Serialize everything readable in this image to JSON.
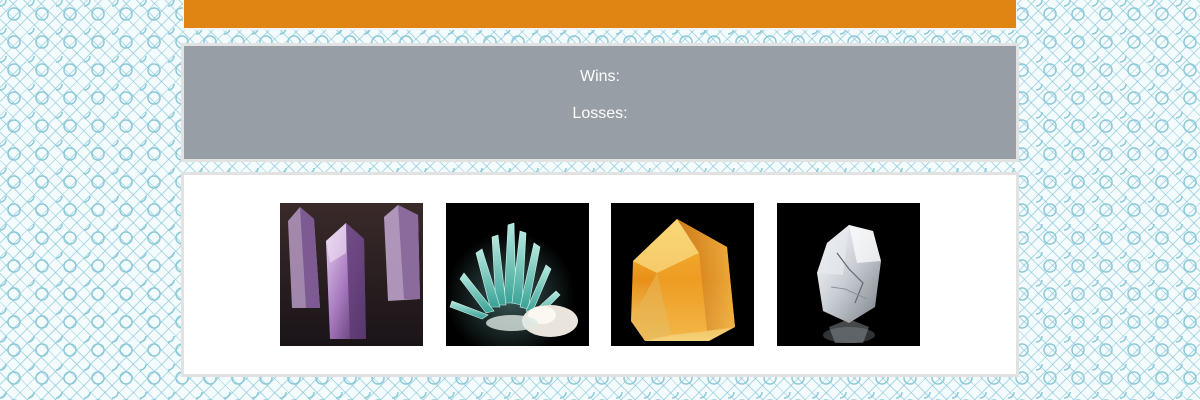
{
  "scoreboard": {
    "wins_label": "Wins:",
    "losses_label": "Losses:"
  },
  "colors": {
    "header": "#e08514",
    "score_panel": "#979ea6",
    "crystal_panel": "#ffffff",
    "border": "#e2e2e2"
  },
  "crystals": [
    {
      "name": "amethyst",
      "color": "#9b6fb3"
    },
    {
      "name": "aquamarine",
      "color": "#7fd6c4"
    },
    {
      "name": "citrine",
      "color": "#e8a020"
    },
    {
      "name": "clear-quartz",
      "color": "#d8dde3"
    }
  ]
}
